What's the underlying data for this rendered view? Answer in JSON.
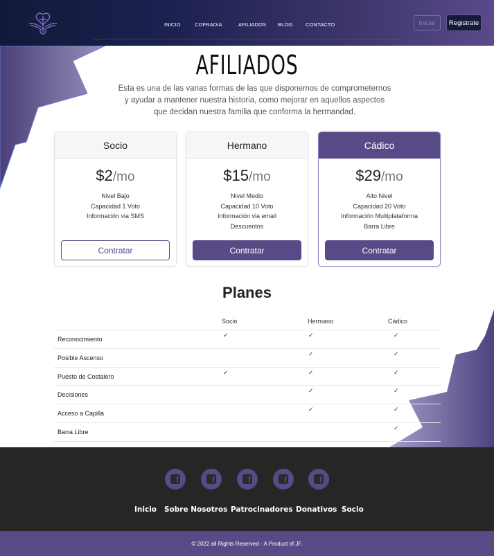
{
  "colors": {
    "primary": "#574a86",
    "header_dark": "#111a3a",
    "footer": "#262626"
  },
  "header": {
    "nav": [
      "INICIO",
      "COFRADIA",
      "AFILIADOS",
      "BLOG",
      "CONTACTO"
    ],
    "login_label": "Iniciar",
    "register_label": "Registrate"
  },
  "hero": {
    "title": "AFILIADOS",
    "intro_lines": [
      "Esta es una de las varias formas de las que disponemos de comprometernos",
      "y ayudar a mantener nuestra historia, como mejorar en aquellos aspectos",
      "que decidan nuestra familia que conforma la hermandad."
    ]
  },
  "pricing": [
    {
      "name": "Socio",
      "price": "$2",
      "period": "/mo",
      "features": [
        "Nivel Bajo",
        "Capacidad 1 Voto",
        "Información via SMS"
      ],
      "cta": "Contratar"
    },
    {
      "name": "Hermano",
      "price": "$15",
      "period": "/mo",
      "features": [
        "Nivel Medio",
        "Capacidad 10 Voto",
        "Información via email",
        "Descuentos"
      ],
      "cta": "Contratar"
    },
    {
      "name": "Cádico",
      "price": "$29",
      "period": "/mo",
      "features": [
        "Alto Nivel",
        "Capacidad 20 Voto",
        "Información Multiplataforma",
        "Barra Libre"
      ],
      "cta": "Contratar"
    }
  ],
  "plans": {
    "title": "Planes",
    "columns": [
      "Socio",
      "Hermano",
      "Cádico"
    ],
    "check_glyph": "✓",
    "rows": [
      {
        "label": "Reconocimiento",
        "checks": [
          true,
          true,
          true
        ]
      },
      {
        "label": "Posible Ascenso",
        "checks": [
          false,
          true,
          true
        ]
      },
      {
        "label": "Puesto de Costalero",
        "checks": [
          true,
          true,
          true
        ]
      },
      {
        "label": "Decisiones",
        "checks": [
          false,
          true,
          true
        ]
      },
      {
        "label": "Acceso a Capilla",
        "checks": [
          false,
          true,
          true
        ]
      },
      {
        "label": "Barra Libre",
        "checks": [
          false,
          false,
          true
        ]
      }
    ]
  },
  "footer": {
    "social_icons": [
      "facebook-icon",
      "facebook-icon",
      "facebook-icon",
      "facebook-icon",
      "facebook-icon"
    ],
    "links": [
      "Inicio",
      "Sobre Nosotros",
      "Patrocinadores",
      "Donativos",
      "Socio"
    ],
    "copyright": "© 2022 all Rights Reserved - A Product of JF."
  }
}
